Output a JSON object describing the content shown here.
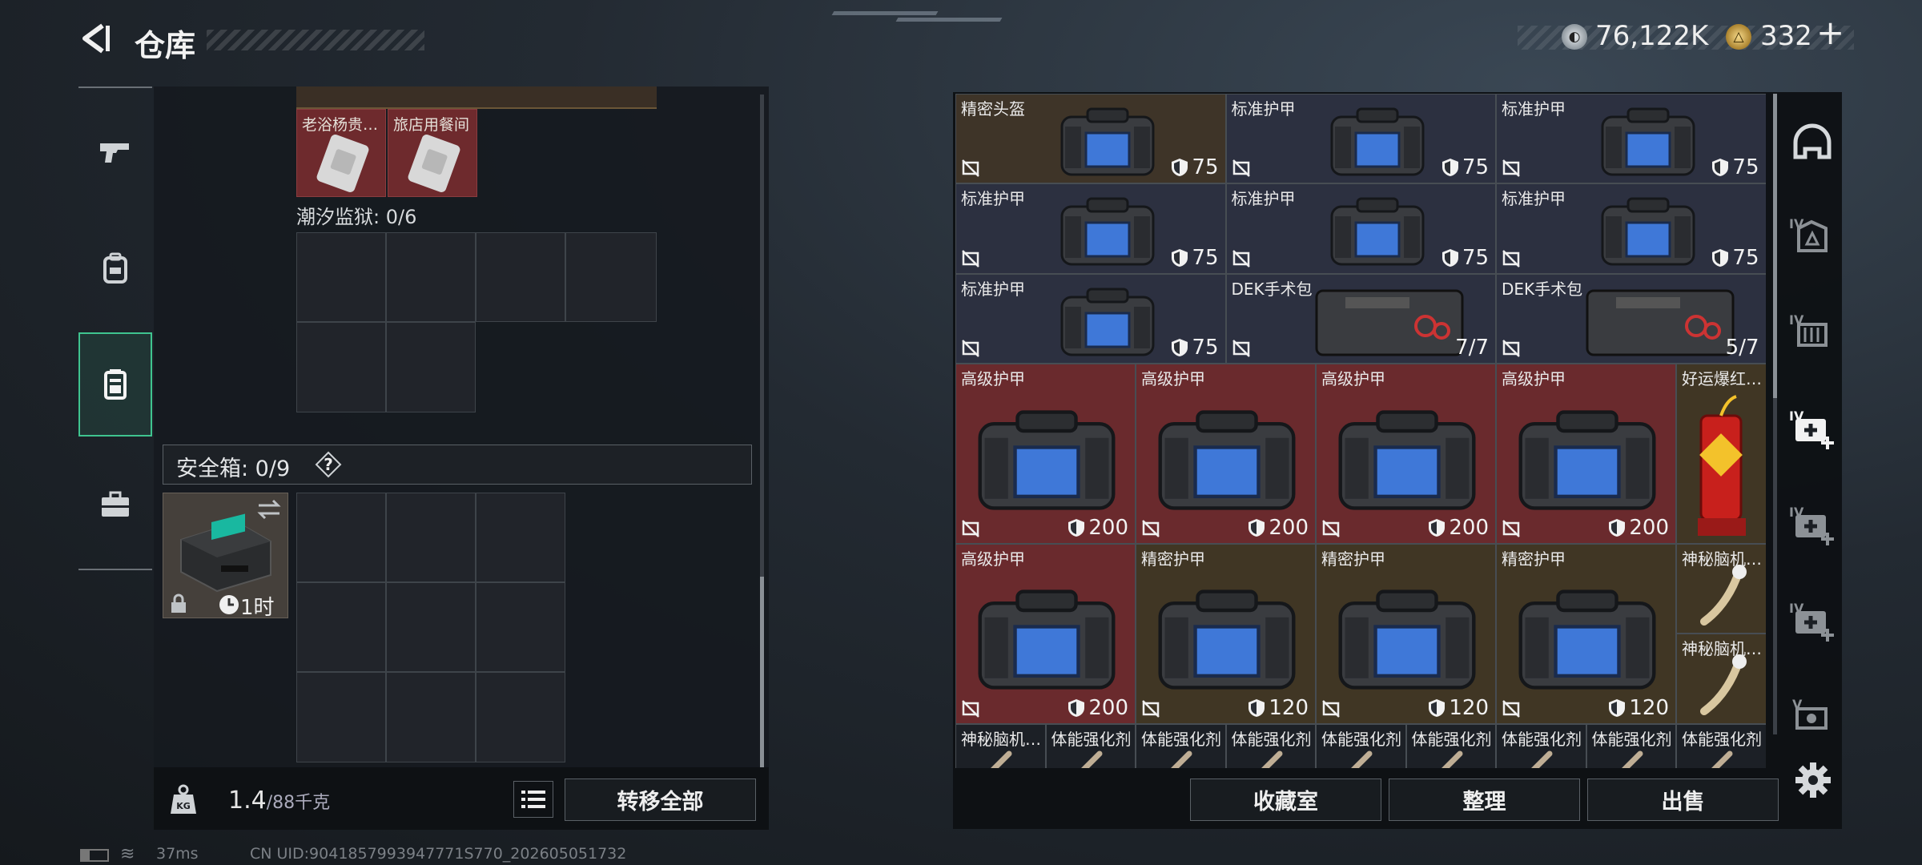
{
  "header": {
    "title": "仓库",
    "currency_silver": "76,122K",
    "currency_gold": "332",
    "plus_label": "+"
  },
  "left_panel": {
    "top_items": [
      {
        "label": "老浴杨贵…"
      },
      {
        "label": "旅店用餐间"
      }
    ],
    "tide_prison_title": "潮汐监狱: 0/6",
    "safe_box_title": "安全箱: 0/9",
    "help_label": "?",
    "safe_box_item_time": "1时",
    "weight_value": "1.4",
    "weight_unit": "/88千克",
    "transfer_all_label": "转移全部"
  },
  "status_bar": {
    "ping": "37ms",
    "uid": "CN UID:9041857993947771S770_202605051732"
  },
  "stash": {
    "items": [
      {
        "label": "精密头盔",
        "value": "75",
        "kind": "durability"
      },
      {
        "label": "标准护甲",
        "value": "75",
        "kind": "durability"
      },
      {
        "label": "标准护甲",
        "value": "75",
        "kind": "durability"
      },
      {
        "label": "标准护甲",
        "value": "75",
        "kind": "durability"
      },
      {
        "label": "标准护甲",
        "value": "75",
        "kind": "durability"
      },
      {
        "label": "标准护甲",
        "value": "75",
        "kind": "durability"
      },
      {
        "label": "标准护甲",
        "value": "75",
        "kind": "durability"
      },
      {
        "label": "DEK手术包",
        "value": "7/7",
        "kind": "uses"
      },
      {
        "label": "DEK手术包",
        "value": "5/7",
        "kind": "uses"
      },
      {
        "label": "高级护甲",
        "value": "200",
        "kind": "durability"
      },
      {
        "label": "高级护甲",
        "value": "200",
        "kind": "durability"
      },
      {
        "label": "高级护甲",
        "value": "200",
        "kind": "durability"
      },
      {
        "label": "高级护甲",
        "value": "200",
        "kind": "durability"
      },
      {
        "label": "好运爆红…",
        "value": "",
        "kind": "none"
      },
      {
        "label": "高级护甲",
        "value": "200",
        "kind": "durability"
      },
      {
        "label": "精密护甲",
        "value": "120",
        "kind": "durability"
      },
      {
        "label": "精密护甲",
        "value": "120",
        "kind": "durability"
      },
      {
        "label": "精密护甲",
        "value": "120",
        "kind": "durability"
      },
      {
        "label": "神秘脑机…",
        "value": "",
        "kind": "none"
      },
      {
        "label": "神秘脑机…",
        "value": "",
        "kind": "none"
      },
      {
        "label": "神秘脑机…",
        "value": "",
        "kind": "none"
      },
      {
        "label": "体能强化剂",
        "value": "",
        "kind": "none"
      },
      {
        "label": "体能强化剂",
        "value": "",
        "kind": "none"
      },
      {
        "label": "体能强化剂",
        "value": "",
        "kind": "none"
      },
      {
        "label": "体能强化剂",
        "value": "",
        "kind": "none"
      },
      {
        "label": "体能强化剂",
        "value": "",
        "kind": "none"
      },
      {
        "label": "体能强化剂",
        "value": "",
        "kind": "none"
      },
      {
        "label": "体能强化剂",
        "value": "",
        "kind": "none"
      },
      {
        "label": "体能强化剂",
        "value": "",
        "kind": "none"
      }
    ],
    "buttons": {
      "collection": "收藏室",
      "organize": "整理",
      "sell": "出售"
    }
  },
  "side_tabs": [
    {
      "label": "IV"
    },
    {
      "label": "IV"
    },
    {
      "label": "IV"
    },
    {
      "label": "IV"
    },
    {
      "label": "IV"
    },
    {
      "label": "V"
    }
  ],
  "icons": [
    "back-icon",
    "pistol-icon",
    "backpack-icon",
    "safe-box-icon",
    "briefcase-icon",
    "weight-icon",
    "list-icon",
    "help-icon",
    "gear-icon",
    "shield-icon",
    "no-insure-icon",
    "clock-icon",
    "lock-icon",
    "swap-icon"
  ],
  "colors": {
    "accent_green": "#3fc48f",
    "tile_red": "#6a2a2d",
    "tile_blue": "#2c3040",
    "tile_olive": "#403624"
  }
}
